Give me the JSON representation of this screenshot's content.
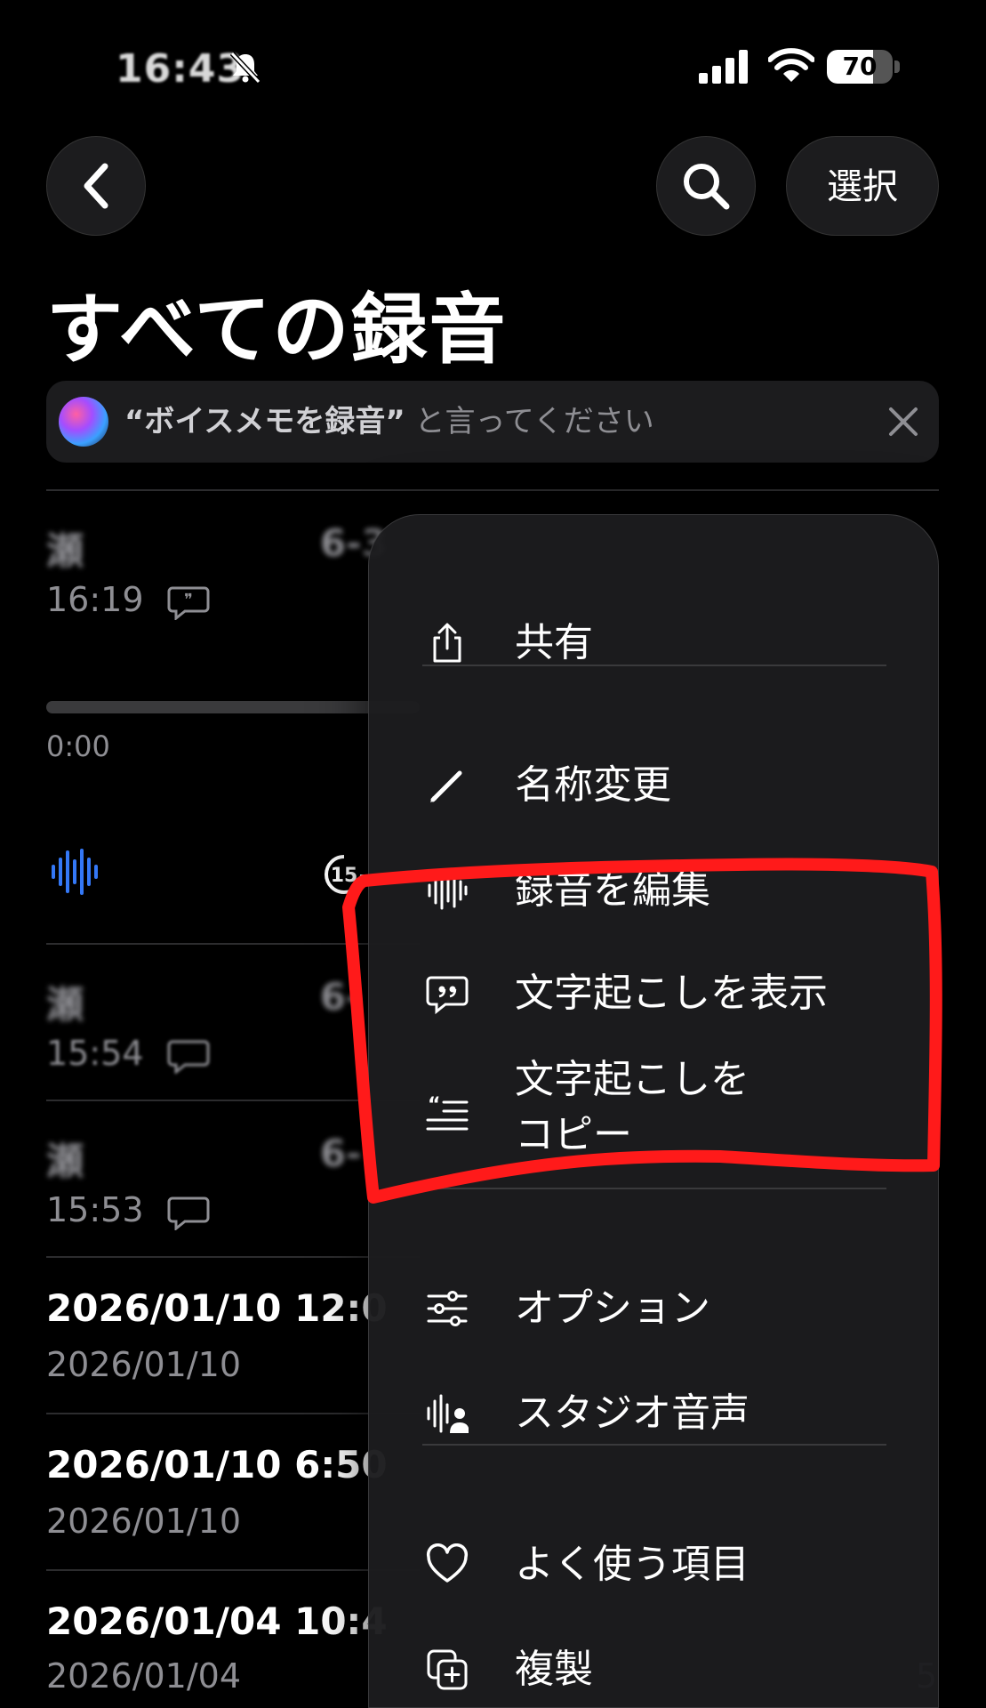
{
  "status_bar": {
    "time": "16:43",
    "battery": "70",
    "battery_level": 0.7
  },
  "header": {
    "select_label": "選択",
    "title": "すべての録音"
  },
  "siri": {
    "quote": "“ボイスメモを録音”",
    "text": " と言ってください"
  },
  "recordings": [
    {
      "title": "瀬",
      "partial": "6-3",
      "subtitle": "16:19",
      "has_transcript": true,
      "blurred": true
    },
    {
      "title": "瀬",
      "partial": "6-",
      "subtitle": "15:54",
      "has_transcript": true,
      "blurred": true
    },
    {
      "title": "瀬",
      "partial": "6-",
      "subtitle": "15:53",
      "has_transcript": true,
      "blurred": true
    },
    {
      "title": "2026/01/10 12:0",
      "subtitle": "2026/01/10"
    },
    {
      "title": "2026/01/10 6:50",
      "subtitle": "2026/01/10"
    },
    {
      "title": "2026/01/04 10:4",
      "subtitle": "2026/01/04"
    }
  ],
  "player": {
    "elapsed": "0:00"
  },
  "menu": {
    "share": "共有",
    "rename": "名称変更",
    "edit": "録音を編集",
    "show_transcript": "文字起こしを表示",
    "copy_transcript_line1": "文字起こしを",
    "copy_transcript_line2": "コピー",
    "options": "オプション",
    "studio_voice": "スタジオ音声",
    "favorites": "よく使う項目",
    "duplicate": "複製"
  },
  "edge_text": "5",
  "colors": {
    "accent_blue": "#3478f6",
    "annotation_red": "#ff1a1a",
    "menu_bg": "#1c1c1e"
  }
}
